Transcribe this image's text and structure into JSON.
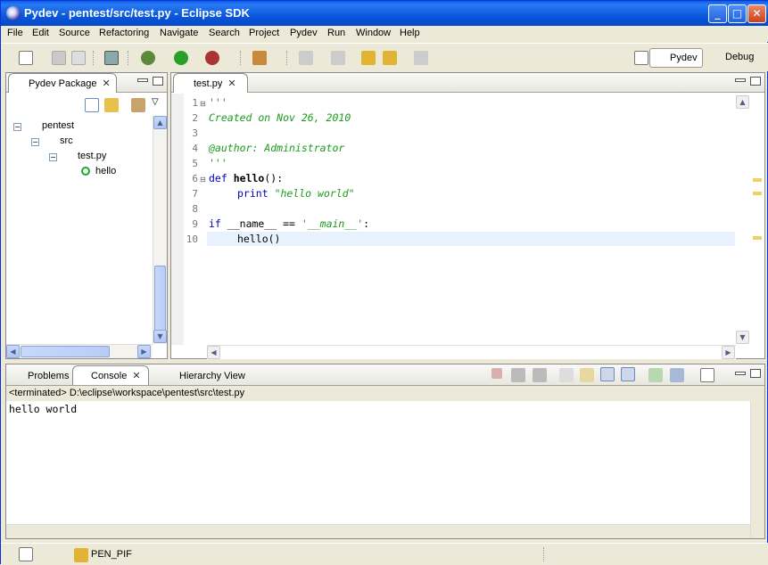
{
  "window": {
    "title": "Pydev - pentest/src/test.py - Eclipse SDK"
  },
  "menu": [
    "File",
    "Edit",
    "Source",
    "Refactoring",
    "Navigate",
    "Search",
    "Project",
    "Pydev",
    "Run",
    "Window",
    "Help"
  ],
  "perspectives": {
    "pydev": "Pydev",
    "debug": "Debug"
  },
  "package_explorer": {
    "tab": "Pydev Package",
    "tree": {
      "project": "pentest",
      "folder": "src",
      "file": "test.py",
      "function": "hello"
    }
  },
  "editor": {
    "tab": "test.py",
    "lines": [
      "1",
      "2",
      "3",
      "4",
      "5",
      "6",
      "7",
      "8",
      "9",
      "10"
    ],
    "code": {
      "l1": "'''",
      "l2": "Created on Nov 26, 2010",
      "l4": "@author: Administrator",
      "l5": "'''",
      "l6_kw": "def",
      "l6_name": "hello",
      "l6_rest": "():",
      "l7_kw": "print",
      "l7_str": "\"hello world\"",
      "l9_kw": "if",
      "l9_mid": "__name__ == ",
      "l9_str": "'__main__'",
      "l9_end": ":",
      "l10": "hello()"
    }
  },
  "bottom": {
    "tabs": {
      "problems": "Problems",
      "console": "Console",
      "hierarchy": "Hierarchy View"
    },
    "console_header": "<terminated> D:\\eclipse\\workspace\\pentest\\src\\test.py",
    "output": "hello world"
  },
  "status": {
    "project": "PEN_PIF"
  }
}
